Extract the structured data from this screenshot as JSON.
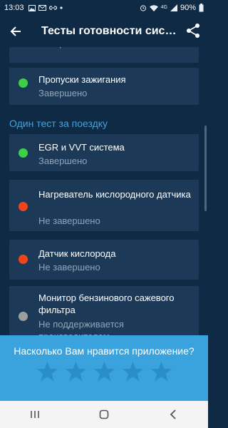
{
  "status_bar": {
    "time": "13:03",
    "icons": [
      "photo-icon",
      "mail-icon",
      "link-icon",
      "dot-icon"
    ],
    "right_icons": [
      "alarm-icon",
      "wifi-icon",
      "4g-icon",
      "signal-icon"
    ],
    "battery": "90%"
  },
  "app_bar": {
    "title": "Тесты готовности сис…",
    "back_icon": "arrow-back-icon",
    "share_icon": "share-icon"
  },
  "top_partial": {
    "state": "Завершено"
  },
  "section1": [
    {
      "name": "Пропуски зажигания",
      "state": "Завершено",
      "status": "green"
    }
  ],
  "section2_title": "Один тест за поездку",
  "section2": [
    {
      "name": "EGR и VVT система",
      "state": "Завершено",
      "status": "green"
    },
    {
      "name": "Нагреватель кислородного датчика",
      "state": "Не завершено",
      "status": "red"
    },
    {
      "name": "Датчик кислорода",
      "state": "Не завершено",
      "status": "red"
    },
    {
      "name": "Монитор бензинового сажевого фильтра",
      "state": "Не поддерживается производителем",
      "status": "gray"
    }
  ],
  "rating": {
    "question": "Насколько Вам нравится приложение?",
    "stars": 5
  },
  "colors": {
    "green": "#3ecf46",
    "red": "#f0441c",
    "gray": "#9e9e9e",
    "accent": "#3aa3de",
    "background": "#0e2a44",
    "card": "#1c3a58"
  },
  "nav_bar": {
    "icons": [
      "recents-icon",
      "home-icon",
      "back-icon"
    ]
  }
}
